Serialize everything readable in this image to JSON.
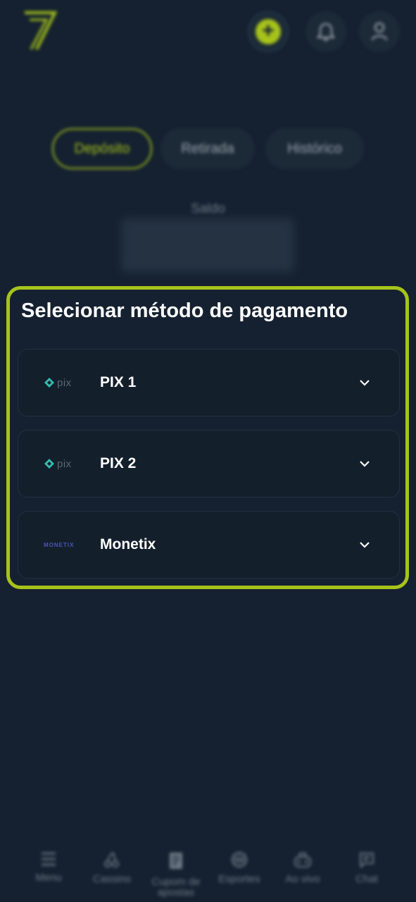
{
  "colors": {
    "accent": "#a7c31b",
    "background": "#152130",
    "card": "#141f2c"
  },
  "header": {
    "logo_icon": "seven-logo-icon",
    "deposit_icon": "plus-icon",
    "notification_icon": "bell-icon",
    "profile_icon": "user-icon"
  },
  "tabs": [
    {
      "label": "Depósito",
      "active": true
    },
    {
      "label": "Retirada",
      "active": false
    },
    {
      "label": "Histórico",
      "active": false
    }
  ],
  "balance": {
    "label": "Saldo"
  },
  "payment": {
    "title": "Selecionar método de pagamento",
    "methods": [
      {
        "label": "PIX 1",
        "logo_text": "pix",
        "logo": "pix-logo-icon"
      },
      {
        "label": "PIX 2",
        "logo_text": "pix",
        "logo": "pix-logo-icon"
      },
      {
        "label": "Monetix",
        "logo_text": "MONETIX",
        "logo": "monetix-logo-icon"
      }
    ]
  },
  "bottom_nav": [
    {
      "label": "Menu",
      "icon": "menu-icon"
    },
    {
      "label": "Cassino",
      "icon": "cherries-icon"
    },
    {
      "label": "Cupom de apostas",
      "icon": "receipt-icon"
    },
    {
      "label": "Esportes",
      "icon": "basketball-icon"
    },
    {
      "label": "Ao vivo",
      "icon": "gamepad-icon"
    },
    {
      "label": "Chat",
      "icon": "chat-icon"
    }
  ]
}
